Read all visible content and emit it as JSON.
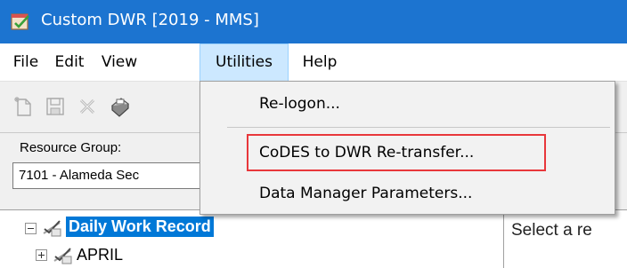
{
  "window": {
    "title": "Custom DWR [2019 - MMS]",
    "app_icon": "calendar-check-icon"
  },
  "menubar": {
    "items": [
      {
        "label": "File"
      },
      {
        "label": "Edit"
      },
      {
        "label": "View"
      },
      {
        "label": "Utilities",
        "active": true
      },
      {
        "label": "Help"
      }
    ]
  },
  "toolbar": {
    "buttons": [
      {
        "icon": "new-document-icon"
      },
      {
        "icon": "save-icon"
      },
      {
        "icon": "delete-icon"
      },
      {
        "icon": "print-icon"
      }
    ]
  },
  "resource_group": {
    "label": "Resource Group:",
    "value": "7101 - Alameda Sec"
  },
  "tree": {
    "root": {
      "label": "Daily Work Record",
      "icon": "check-list-icon",
      "selected": true
    },
    "children": [
      {
        "label": "APRIL",
        "icon": "check-list-icon"
      }
    ]
  },
  "right_panel": {
    "text": "Select a re"
  },
  "utilities_menu": {
    "items": [
      {
        "label": "Re-logon..."
      },
      {
        "label": "CoDES to DWR Re-transfer...",
        "highlighted": true
      },
      {
        "label": "Data Manager Parameters..."
      }
    ],
    "highlight_color": "#e8373b"
  },
  "colors": {
    "titlebar": "#1c74d0",
    "selection": "#0078d7",
    "menu_active": "#cce8ff"
  }
}
